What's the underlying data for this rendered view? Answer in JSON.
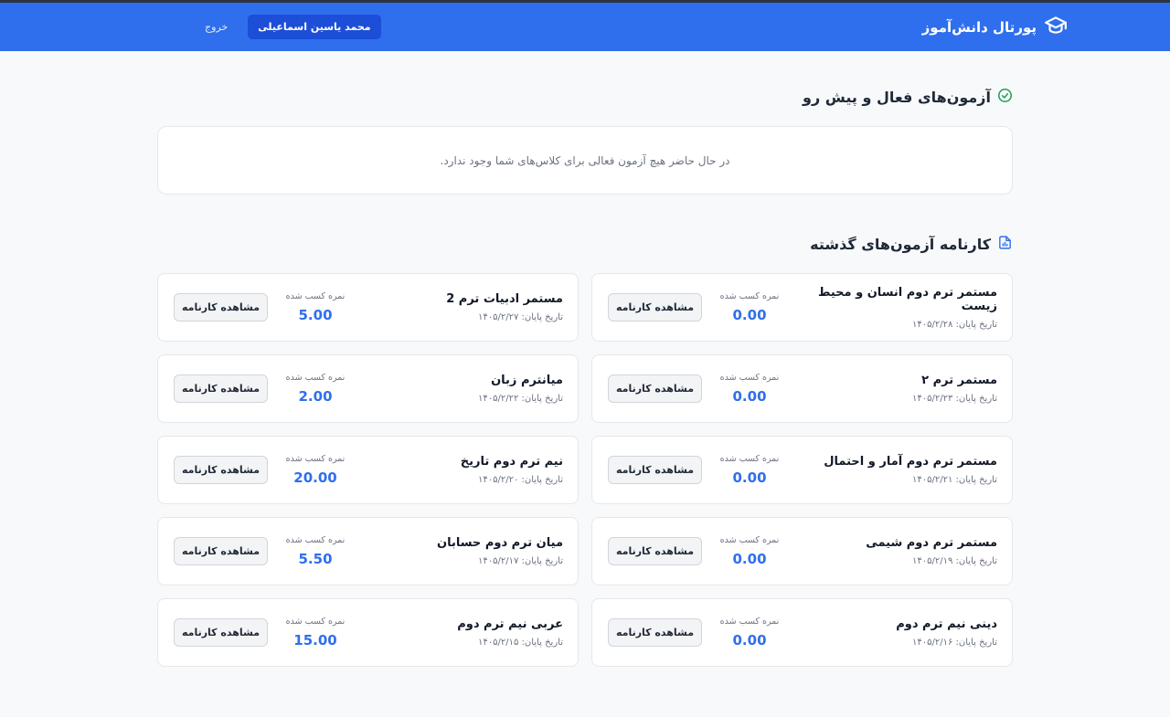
{
  "header": {
    "title": "پورتال دانش‌آموز",
    "user_name": "محمد یاسین اسماعیلی",
    "logout_label": "خروج",
    "accent": "#2f6fed"
  },
  "active_exams": {
    "title": "آزمون‌های فعال و پیش رو",
    "empty_message": "در حال حاضر هیچ آزمون فعالی برای کلاس‌های شما وجود ندارد."
  },
  "past_exams": {
    "title": "کارنامه آزمون‌های گذشته",
    "score_label": "نمره کسب شده",
    "view_label": "مشاهده کارنامه",
    "date_prefix": "تاریخ پایان:",
    "items": [
      {
        "title": "مستمر ترم دوم انسان و محیط زیست",
        "date": "تاریخ پایان: ۱۴۰۵/۲/۲۸",
        "score": "0.00"
      },
      {
        "title": "مستمر ادبیات ترم 2",
        "date": "تاریخ پایان: ۱۴۰۵/۲/۲۷",
        "score": "5.00"
      },
      {
        "title": "مستمر ترم ۲",
        "date": "تاریخ پایان: ۱۴۰۵/۲/۲۳",
        "score": "0.00"
      },
      {
        "title": "میانترم زبان",
        "date": "تاریخ پایان: ۱۴۰۵/۲/۲۲",
        "score": "2.00"
      },
      {
        "title": "مستمر ترم دوم آمار و احتمال",
        "date": "تاریخ پایان: ۱۴۰۵/۲/۲۱",
        "score": "0.00"
      },
      {
        "title": "نیم ترم دوم تاریخ",
        "date": "تاریخ پایان: ۱۴۰۵/۲/۲۰",
        "score": "20.00"
      },
      {
        "title": "مستمر ترم دوم شیمی",
        "date": "تاریخ پایان: ۱۴۰۵/۲/۱۹",
        "score": "0.00"
      },
      {
        "title": "میان ترم دوم حسابان",
        "date": "تاریخ پایان: ۱۴۰۵/۲/۱۷",
        "score": "5.50"
      },
      {
        "title": "دینی نیم ترم دوم",
        "date": "تاریخ پایان: ۱۴۰۵/۲/۱۶",
        "score": "0.00"
      },
      {
        "title": "عربی نیم ترم دوم",
        "date": "تاریخ پایان: ۱۴۰۵/۲/۱۵",
        "score": "15.00"
      }
    ]
  },
  "icons": {
    "brand": "graduation-cap-icon",
    "active": "check-circle-icon",
    "past": "report-chart-icon"
  }
}
